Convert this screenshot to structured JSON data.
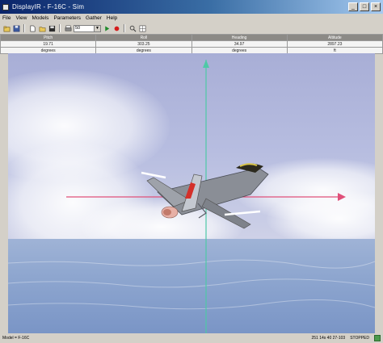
{
  "window": {
    "title": "DisplayIR - F-16C - Sim",
    "buttons": {
      "minimize": "_",
      "maximize": "□",
      "close": "×"
    }
  },
  "menu": {
    "items": [
      "File",
      "View",
      "Models",
      "Parameters",
      "Gather",
      "Help"
    ]
  },
  "toolbar": {
    "combo_value": "50",
    "icons": [
      "open-folder-icon",
      "save-icon",
      "new-file-icon",
      "open-icon",
      "save-disk-icon",
      "print-icon",
      "play-icon",
      "record-icon",
      "zoom-icon",
      "grid-icon"
    ]
  },
  "telemetry": {
    "columns": [
      {
        "header": "Pitch",
        "value": "19.71",
        "unit": "degrees"
      },
      {
        "header": "Roll",
        "value": "303.25",
        "unit": "degrees"
      },
      {
        "header": "Heading",
        "value": "34.97",
        "unit": "degrees"
      },
      {
        "header": "Altitude",
        "value": "2897.23",
        "unit": "ft"
      }
    ]
  },
  "status": {
    "left": "Model = F-16C",
    "right": "251  14s 40 27-103",
    "state": "STOPPED"
  },
  "colors": {
    "title_gradient_start": "#0a246a",
    "roll_axis": "#e0507a",
    "vertical_axis": "#4ec9a6",
    "window_bg": "#d4d0c8"
  }
}
